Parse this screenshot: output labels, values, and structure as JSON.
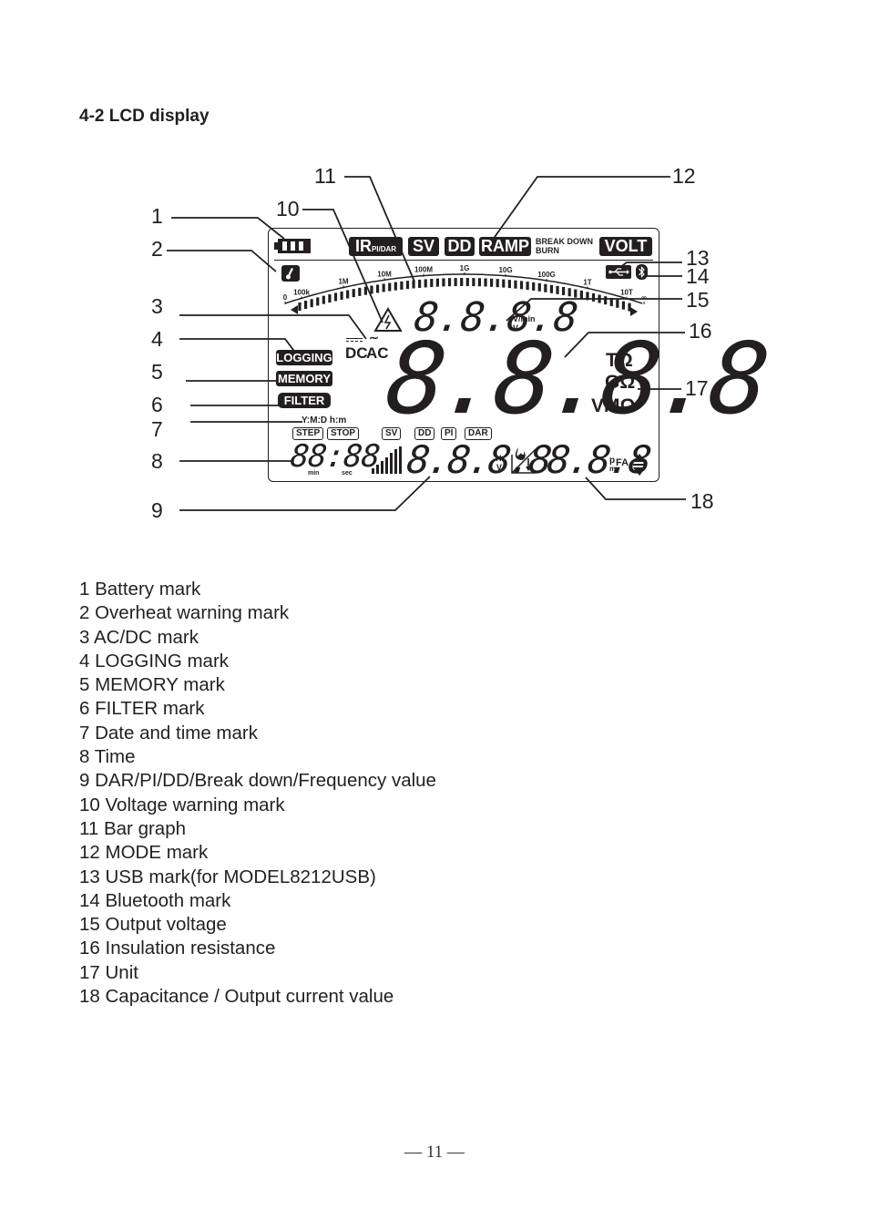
{
  "section_heading": "4-2 LCD display",
  "callouts": [
    "1",
    "2",
    "3",
    "4",
    "5",
    "6",
    "7",
    "8",
    "9",
    "10",
    "11",
    "12",
    "13",
    "14",
    "15",
    "16",
    "17",
    "18"
  ],
  "lcd": {
    "mode_marks": {
      "ir": "IR",
      "ir_sub": "PI/DAR",
      "sv": "SV",
      "dd": "DD",
      "ramp": "RAMP",
      "break_down": "BREAK DOWN",
      "burn": "BURN",
      "volt": "VOLT"
    },
    "bargraph_scale": [
      "0",
      "100k",
      "1M",
      "10M",
      "100M",
      "1G",
      "10G",
      "100G",
      "1T",
      "10T",
      "∞"
    ],
    "output_voltage_digits": "8.8.8.8",
    "output_voltage_units": [
      "V/min",
      "V"
    ],
    "dc_label": "DC",
    "ac_label": "AC",
    "logging": "LOGGING",
    "memory": "MEMORY",
    "filter": "FILTER",
    "main_digits": "8.8.8.8",
    "units": [
      "TΩ",
      "GΩ",
      "VMΩ"
    ],
    "date_time_label": "Y:M:D h:m",
    "step": "STEP",
    "stop": "STOP",
    "sub_tags": [
      "SV",
      "DD",
      "PI",
      "DAR"
    ],
    "time_digits": "88:88",
    "time_units": [
      "min",
      "sec"
    ],
    "secondary_digits": "8.8.8.8",
    "secondary_units": [
      "Hz",
      "V"
    ],
    "cap_digits": "8.8.8",
    "cap_units": [
      "p",
      "m",
      "FA"
    ],
    "icons": {
      "battery": "battery-icon",
      "overheat": "thermometer-icon",
      "usb": "usb-icon",
      "bluetooth": "bluetooth-icon",
      "voltage_warning": "high-voltage-warning-icon",
      "burn": "flame-icon",
      "updown": "up-down-arrows-icon"
    }
  },
  "legend": [
    "1 Battery mark",
    "2 Overheat warning mark",
    "3 AC/DC mark",
    "4 LOGGING mark",
    "5 MEMORY mark",
    "6 FILTER mark",
    "7 Date and time mark",
    "8 Time",
    "9 DAR/PI/DD/Break down/Frequency value",
    "10 Voltage warning mark",
    "11 Bar graph",
    "12 MODE mark",
    "13 USB mark(for MODEL8212USB)",
    "14 Bluetooth mark",
    "15 Output voltage",
    "16 Insulation resistance",
    "17 Unit",
    "18 Capacitance / Output current value"
  ],
  "page_number": "— 11 —"
}
